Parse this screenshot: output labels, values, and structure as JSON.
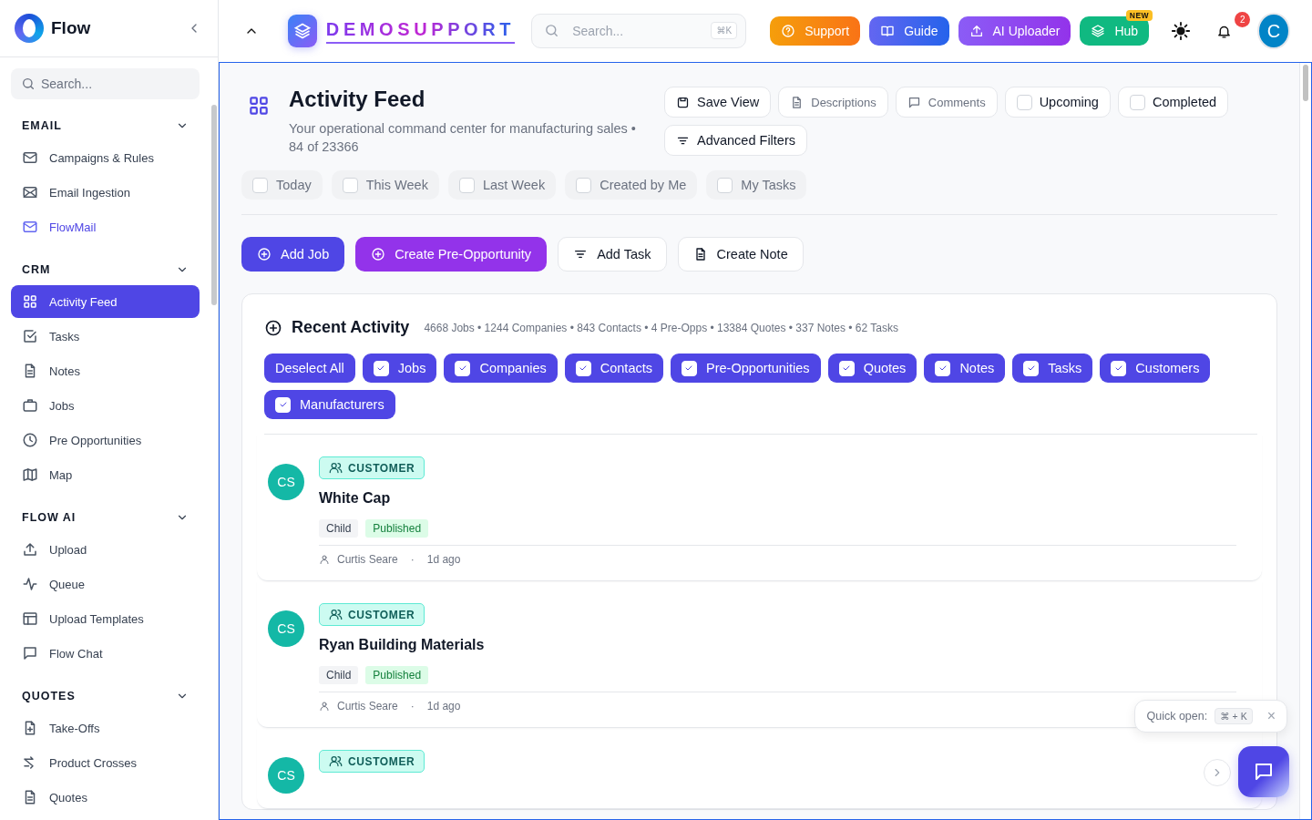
{
  "sidebar": {
    "brand": "Flow",
    "search": {
      "placeholder": "Search..."
    },
    "sections": [
      {
        "title": "EMAIL",
        "expanded": true,
        "items": [
          {
            "label": "Campaigns & Rules",
            "selected": false,
            "accent": false
          },
          {
            "label": "Email Ingestion",
            "selected": false,
            "accent": false
          },
          {
            "label": "FlowMail",
            "selected": false,
            "accent": true
          }
        ]
      },
      {
        "title": "CRM",
        "expanded": true,
        "items": [
          {
            "label": "Activity Feed",
            "selected": true,
            "accent": false
          },
          {
            "label": "Tasks",
            "selected": false,
            "accent": false
          },
          {
            "label": "Notes",
            "selected": false,
            "accent": false
          },
          {
            "label": "Jobs",
            "selected": false,
            "accent": false
          },
          {
            "label": "Pre Opportunities",
            "selected": false,
            "accent": false
          },
          {
            "label": "Map",
            "selected": false,
            "accent": false
          }
        ]
      },
      {
        "title": "FLOW AI",
        "expanded": true,
        "items": [
          {
            "label": "Upload",
            "selected": false,
            "accent": false
          },
          {
            "label": "Queue",
            "selected": false,
            "accent": false
          },
          {
            "label": "Upload Templates",
            "selected": false,
            "accent": false
          },
          {
            "label": "Flow Chat",
            "selected": false,
            "accent": false
          }
        ]
      },
      {
        "title": "QUOTES",
        "expanded": true,
        "items": [
          {
            "label": "Take-Offs",
            "selected": false,
            "accent": false
          },
          {
            "label": "Product Crosses",
            "selected": false,
            "accent": false
          },
          {
            "label": "Quotes",
            "selected": false,
            "accent": false
          }
        ]
      }
    ]
  },
  "topbar": {
    "brand": "DEMOSUPPORT",
    "search": {
      "placeholder": "Search...",
      "shortcut": "⌘K"
    },
    "buttons": [
      {
        "label": "Support",
        "kind": "support"
      },
      {
        "label": "Guide",
        "kind": "guide"
      },
      {
        "label": "AI Uploader",
        "kind": "uploader"
      },
      {
        "label": "Hub",
        "kind": "hub",
        "badge": "NEW"
      }
    ],
    "notifications": "2",
    "avatar": "C"
  },
  "page": {
    "title": "Activity Feed",
    "subtitle": "Your operational command center for manufacturing sales •",
    "count": "84 of 23366",
    "toolbar": [
      {
        "label": "Save View",
        "kind": "save"
      },
      {
        "label": "Descriptions",
        "kind": "descriptions"
      },
      {
        "label": "Comments",
        "kind": "comments"
      },
      {
        "label": "Upcoming",
        "kind": "check",
        "checked": false
      },
      {
        "label": "Completed",
        "kind": "check",
        "checked": false
      },
      {
        "label": "Advanced Filters",
        "kind": "filters"
      }
    ],
    "date_filters": [
      {
        "label": "Today",
        "checked": false
      },
      {
        "label": "This Week",
        "checked": false
      },
      {
        "label": "Last Week",
        "checked": false
      },
      {
        "label": "Created by Me",
        "checked": false
      },
      {
        "label": "My Tasks",
        "checked": false
      }
    ],
    "actions": [
      {
        "label": "Add Job",
        "kind": "primary"
      },
      {
        "label": "Create Pre-Opportunity",
        "kind": "purple"
      },
      {
        "label": "Add Task",
        "kind": "outline"
      },
      {
        "label": "Create Note",
        "kind": "outline"
      }
    ]
  },
  "recent": {
    "title": "Recent Activity",
    "stats": "4668 Jobs • 1244 Companies • 843 Contacts • 4 Pre-Opps • 13384 Quotes • 337 Notes • 62 Tasks",
    "filters": [
      {
        "label": "Deselect All",
        "kind": "button"
      },
      {
        "label": "Jobs",
        "kind": "check",
        "checked": true
      },
      {
        "label": "Companies",
        "kind": "check",
        "checked": true
      },
      {
        "label": "Contacts",
        "kind": "check",
        "checked": true
      },
      {
        "label": "Pre-Opportunities",
        "kind": "check",
        "checked": true
      },
      {
        "label": "Quotes",
        "kind": "check",
        "checked": true
      },
      {
        "label": "Notes",
        "kind": "check",
        "checked": true
      },
      {
        "label": "Tasks",
        "kind": "check",
        "checked": true
      },
      {
        "label": "Customers",
        "kind": "check",
        "checked": true
      },
      {
        "label": "Manufacturers",
        "kind": "check",
        "checked": true
      }
    ],
    "items": [
      {
        "initials": "CS",
        "type": "CUSTOMER",
        "title": "White Cap",
        "tags": [
          {
            "label": "Child",
            "kind": "plain"
          },
          {
            "label": "Published",
            "kind": "success"
          }
        ],
        "author": "Curtis Seare",
        "separator": "·",
        "time": "1d ago"
      },
      {
        "initials": "CS",
        "type": "CUSTOMER",
        "title": "Ryan Building Materials",
        "tags": [
          {
            "label": "Child",
            "kind": "plain"
          },
          {
            "label": "Published",
            "kind": "success"
          }
        ],
        "author": "Curtis Seare",
        "separator": "·",
        "time": "1d ago"
      },
      {
        "initials": "CS",
        "type": "CUSTOMER"
      }
    ]
  },
  "toast": {
    "label": "Quick open:",
    "shortcut": "⌘ + K",
    "close": "×"
  }
}
